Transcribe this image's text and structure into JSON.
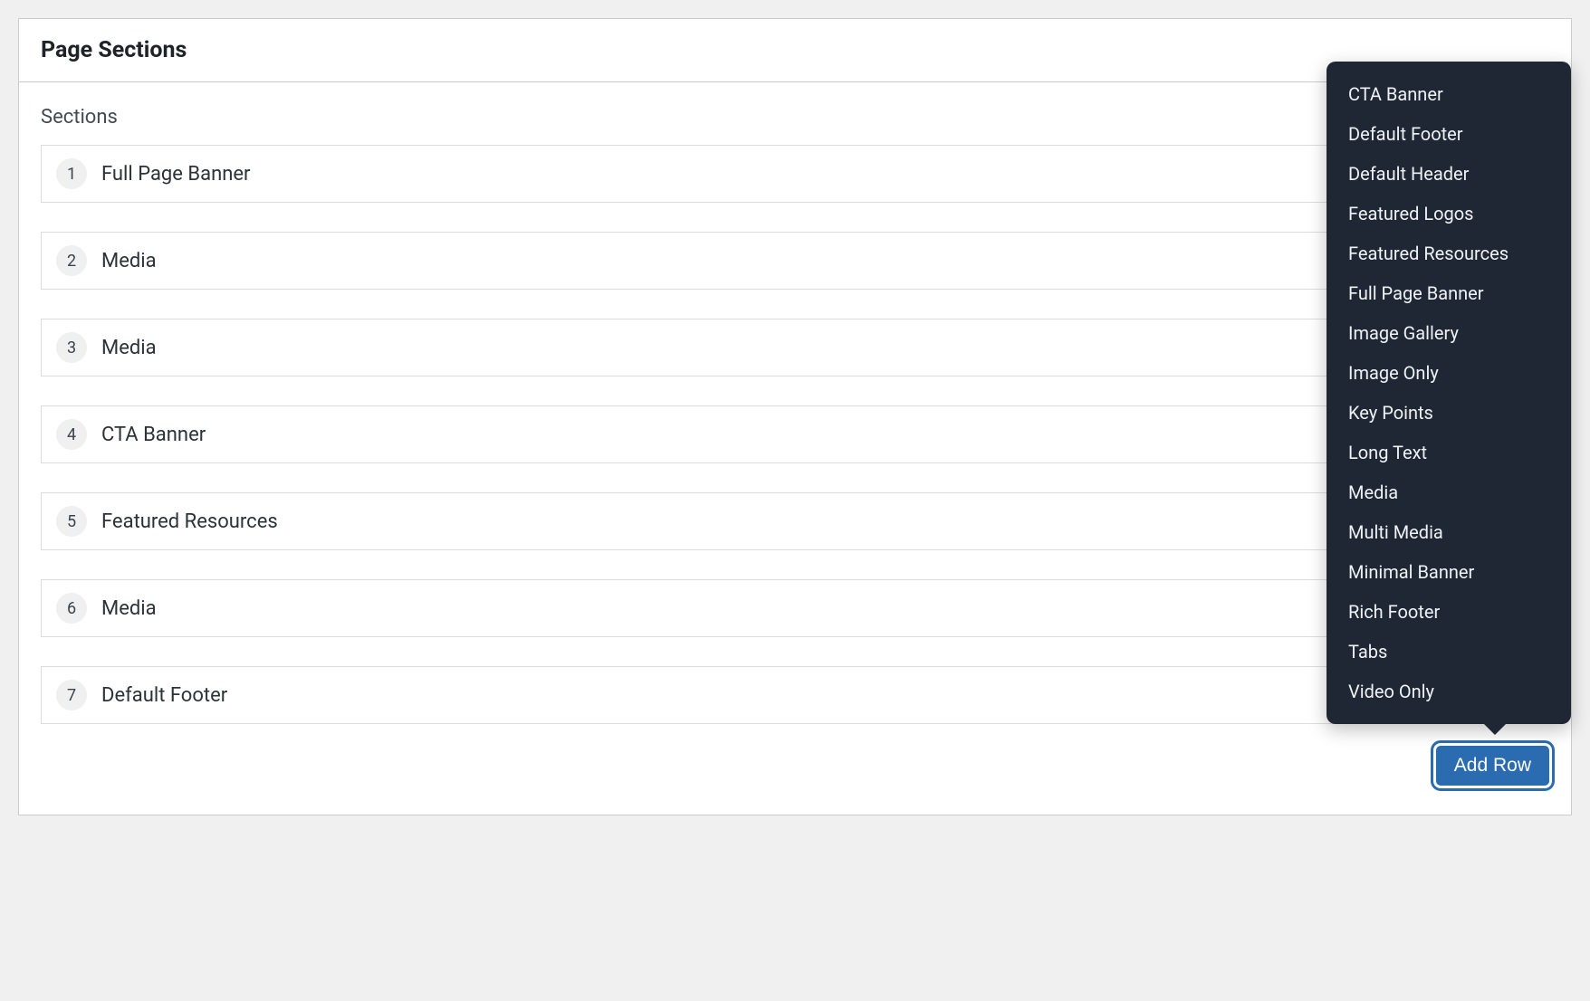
{
  "panel": {
    "title": "Page Sections",
    "field_label": "Sections",
    "add_row_label": "Add Row"
  },
  "rows": [
    {
      "index": "1",
      "label": "Full Page Banner"
    },
    {
      "index": "2",
      "label": "Media"
    },
    {
      "index": "3",
      "label": "Media"
    },
    {
      "index": "4",
      "label": "CTA Banner"
    },
    {
      "index": "5",
      "label": "Featured Resources"
    },
    {
      "index": "6",
      "label": "Media"
    },
    {
      "index": "7",
      "label": "Default Footer"
    }
  ],
  "popover": {
    "items": [
      "CTA Banner",
      "Default Footer",
      "Default Header",
      "Featured Logos",
      "Featured Resources",
      "Full Page Banner",
      "Image Gallery",
      "Image Only",
      "Key Points",
      "Long Text",
      "Media",
      "Multi Media",
      "Minimal Banner",
      "Rich Footer",
      "Tabs",
      "Video Only"
    ]
  }
}
